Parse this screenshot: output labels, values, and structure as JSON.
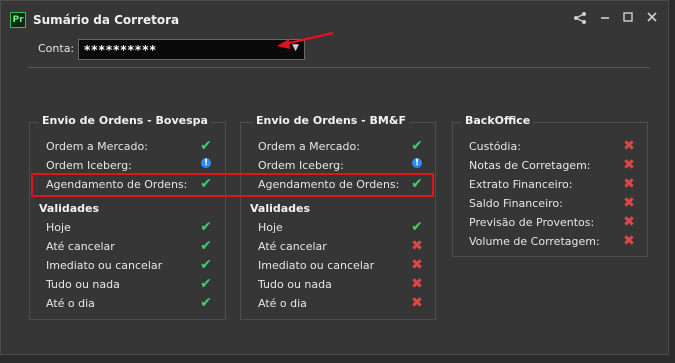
{
  "window": {
    "title": "Sumário da Corretora",
    "icon_label": "Pr"
  },
  "conta": {
    "label": "Conta:",
    "value": "**********"
  },
  "bovespa": {
    "title": "Envio de Ordens - Bovespa",
    "rows": [
      {
        "label": "Ordem a Mercado:",
        "status": "ok"
      },
      {
        "label": "Ordem Iceberg:",
        "status": "info"
      },
      {
        "label": "Agendamento de Ordens:",
        "status": "ok"
      }
    ],
    "validades_title": "Validades",
    "validades": [
      {
        "label": "Hoje",
        "status": "ok"
      },
      {
        "label": "Até cancelar",
        "status": "ok"
      },
      {
        "label": "Imediato ou cancelar",
        "status": "ok"
      },
      {
        "label": "Tudo ou nada",
        "status": "ok"
      },
      {
        "label": "Até o dia",
        "status": "ok"
      }
    ]
  },
  "bmf": {
    "title": "Envio de Ordens - BM&F",
    "rows": [
      {
        "label": "Ordem a Mercado:",
        "status": "ok"
      },
      {
        "label": "Ordem Iceberg:",
        "status": "info"
      },
      {
        "label": "Agendamento de Ordens:",
        "status": "ok"
      }
    ],
    "validades_title": "Validades",
    "validades": [
      {
        "label": "Hoje",
        "status": "ok"
      },
      {
        "label": "Até cancelar",
        "status": "no"
      },
      {
        "label": "Imediato ou cancelar",
        "status": "no"
      },
      {
        "label": "Tudo ou nada",
        "status": "no"
      },
      {
        "label": "Até o dia",
        "status": "no"
      }
    ]
  },
  "backoffice": {
    "title": "BackOffice",
    "rows": [
      {
        "label": "Custódia:",
        "status": "no"
      },
      {
        "label": "Notas de Corretagem:",
        "status": "no"
      },
      {
        "label": "Extrato Financeiro:",
        "status": "no"
      },
      {
        "label": "Saldo Financeiro:",
        "status": "no"
      },
      {
        "label": "Previsão de Proventos:",
        "status": "no"
      },
      {
        "label": "Volume de Corretagem:",
        "status": "no"
      }
    ]
  },
  "icons": {
    "share": "share-icon",
    "minimize": "minimize-icon",
    "maximize": "maximize-icon",
    "close": "close-icon"
  },
  "colors": {
    "ok": "#3fcf6a",
    "no": "#e04646",
    "info": "#2e8ef0",
    "highlight": "#e3121f",
    "annotation_arrow": "#e3121f"
  }
}
